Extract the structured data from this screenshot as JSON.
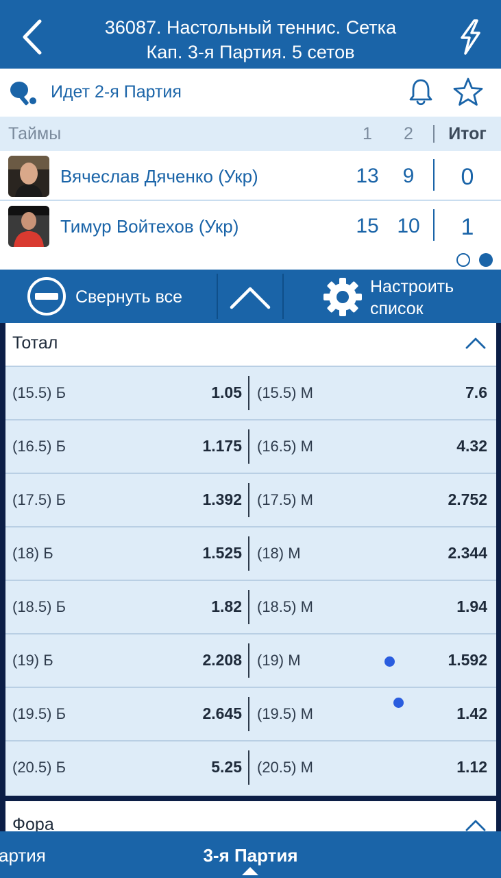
{
  "header": {
    "title_line1": "36087. Настольный теннис. Сетка",
    "title_line2": "Кап. 3-я  Партия. 5 сетов",
    "back_icon": "chevron-left-icon",
    "action_icon": "lightning-icon"
  },
  "match": {
    "status": "Идет 2-я  Партия",
    "sport_icon": "table-tennis-icon",
    "bell_icon": "bell-icon",
    "star_icon": "star-icon"
  },
  "score_table": {
    "header_label": "Таймы",
    "col1": "1",
    "col2": "2",
    "total_label": "Итог",
    "players": [
      {
        "name": "Вячеслав Дяченко (Укр)",
        "set1": "13",
        "set2": "9",
        "total": "0"
      },
      {
        "name": "Тимур Войтехов (Укр)",
        "set1": "15",
        "set2": "10",
        "total": "1"
      }
    ],
    "page_indicator": {
      "pages": 2,
      "active": 2
    }
  },
  "toolbar": {
    "collapse_label": "Свернуть все",
    "config_line1": "Настроить",
    "config_line2": "список"
  },
  "market": {
    "title": "Тотал",
    "rows": [
      {
        "left_label": "(15.5) Б",
        "left_odds": "1.05",
        "right_label": "(15.5) М",
        "right_odds": "7.6"
      },
      {
        "left_label": "(16.5) Б",
        "left_odds": "1.175",
        "right_label": "(16.5) М",
        "right_odds": "4.32"
      },
      {
        "left_label": "(17.5) Б",
        "left_odds": "1.392",
        "right_label": "(17.5) М",
        "right_odds": "2.752"
      },
      {
        "left_label": "(18) Б",
        "left_odds": "1.525",
        "right_label": "(18) М",
        "right_odds": "2.344"
      },
      {
        "left_label": "(18.5) Б",
        "left_odds": "1.82",
        "right_label": "(18.5) М",
        "right_odds": "1.94"
      },
      {
        "left_label": "(19) Б",
        "left_odds": "2.208",
        "right_label": "(19) М",
        "right_odds": "1.592"
      },
      {
        "left_label": "(19.5) Б",
        "left_odds": "2.645",
        "right_label": "(19.5) М",
        "right_odds": "1.42"
      },
      {
        "left_label": "(20.5) Б",
        "left_odds": "5.25",
        "right_label": "(20.5) М",
        "right_odds": "1.12"
      }
    ]
  },
  "market2": {
    "title": "Фора"
  },
  "tabs": {
    "previous": "артия",
    "current": "3-я  Партия"
  },
  "colors": {
    "primary": "#1a64a8",
    "light_row": "#deecf8",
    "dot": "#2a5ddf"
  }
}
